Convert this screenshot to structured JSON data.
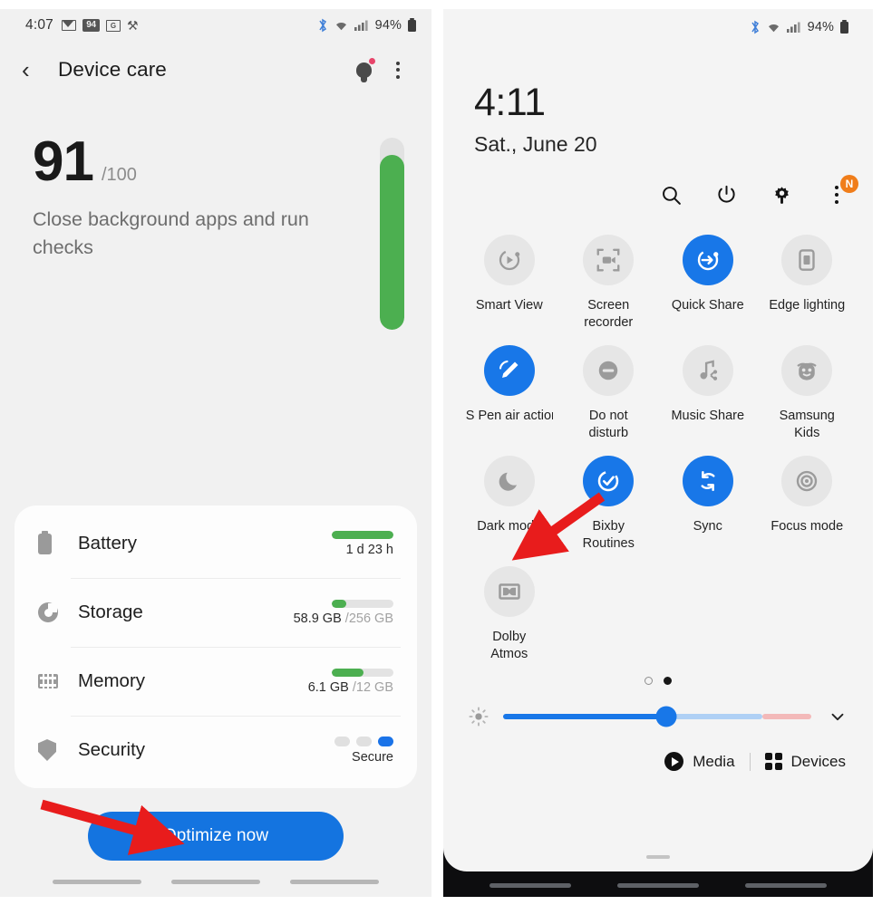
{
  "left_phone": {
    "status_bar": {
      "time": "4:07",
      "left_icons": [
        "gmail-icon",
        "badge-94-icon",
        "contacts-icon",
        "app-icon"
      ],
      "badge_count": "94",
      "right_icons": [
        "bluetooth-icon",
        "wifi-icon",
        "signal-icon"
      ],
      "battery_percent": "94%"
    },
    "header": {
      "back_label": "‹",
      "title": "Device care",
      "bulb_icon": "tips-bulb-icon",
      "more_icon": "overflow-menu-icon"
    },
    "score": {
      "value": "91",
      "max": "/100",
      "description": "Close background apps and run checks",
      "gauge_percent": 91,
      "gauge_color": "#4caf50"
    },
    "care_rows": [
      {
        "icon": "battery-icon",
        "label": "Battery",
        "bar_percent": 100,
        "sub_primary": "1 d 23 h",
        "sub_secondary": "",
        "type": "bar"
      },
      {
        "icon": "storage-pie-icon",
        "label": "Storage",
        "bar_percent": 23,
        "sub_primary": "58.9 GB",
        "sub_secondary": "/256 GB",
        "type": "bar"
      },
      {
        "icon": "memory-chip-icon",
        "label": "Memory",
        "bar_percent": 51,
        "sub_primary": "6.1 GB",
        "sub_secondary": "/12 GB",
        "type": "bar"
      },
      {
        "icon": "shield-icon",
        "label": "Security",
        "sub_primary": "Secure",
        "sub_secondary": "",
        "type": "dots",
        "dots_active_index": 2,
        "dots_count": 3,
        "dot_active_color": "#1a73e8"
      }
    ],
    "optimize_button": {
      "label": "Optimize now",
      "color": "#1474e0"
    },
    "nav_bar_items": [
      "recents-nav",
      "home-nav",
      "back-nav"
    ]
  },
  "right_phone": {
    "status_bar": {
      "right_icons": [
        "bluetooth-icon",
        "wifi-icon",
        "signal-icon"
      ],
      "battery_percent": "94%"
    },
    "clock": {
      "time": "4:11",
      "date": "Sat., June 20"
    },
    "actions": [
      {
        "name": "search-icon",
        "label": "Search",
        "badge": ""
      },
      {
        "name": "power-icon",
        "label": "Power",
        "badge": ""
      },
      {
        "name": "gear-icon",
        "label": "Settings",
        "badge": ""
      },
      {
        "name": "overflow-menu-icon",
        "label": "More options",
        "badge": "N"
      }
    ],
    "badge_color": "#f07d1a",
    "tiles": [
      {
        "label": "Smart View",
        "icon": "smart-view-icon",
        "active": false
      },
      {
        "label": "Screen\nrecorder",
        "icon": "screen-recorder-icon",
        "active": false
      },
      {
        "label": "Quick Share",
        "icon": "quick-share-icon",
        "active": true
      },
      {
        "label": "Edge lighting",
        "icon": "edge-lighting-icon",
        "active": false
      },
      {
        "label": "S Pen air actions",
        "icon": "s-pen-icon",
        "active": true
      },
      {
        "label": "Do not\ndisturb",
        "icon": "do-not-disturb-icon",
        "active": false
      },
      {
        "label": "Music Share",
        "icon": "music-share-icon",
        "active": false
      },
      {
        "label": "Samsung\nKids",
        "icon": "samsung-kids-icon",
        "active": false
      },
      {
        "label": "Dark mode",
        "icon": "moon-icon",
        "active": false
      },
      {
        "label": "Bixby\nRoutines",
        "icon": "bixby-routines-icon",
        "active": true
      },
      {
        "label": "Sync",
        "icon": "sync-icon",
        "active": true
      },
      {
        "label": "Focus mode",
        "icon": "focus-mode-icon",
        "active": false
      },
      {
        "label": "Dolby\nAtmos",
        "icon": "dolby-atmos-icon",
        "active": false
      }
    ],
    "active_tile_color": "#1877e8",
    "page_dots": {
      "count": 2,
      "active_index": 1
    },
    "brightness": {
      "icon": "brightness-icon",
      "value_percent": 53,
      "expand_icon": "chevron-down-icon"
    },
    "bottom_bar": {
      "media_label": "Media",
      "media_icon": "play-icon",
      "devices_label": "Devices",
      "devices_icon": "grid-icon"
    },
    "nav_bar_items": [
      "recents-nav",
      "home-nav",
      "back-nav"
    ]
  },
  "annotations": {
    "arrow_color": "#e81c1c",
    "arrows": [
      {
        "name": "arrow-to-optimize-button",
        "target": "Optimize now"
      },
      {
        "name": "arrow-to-dark-mode-tile",
        "target": "Dark mode"
      }
    ]
  }
}
